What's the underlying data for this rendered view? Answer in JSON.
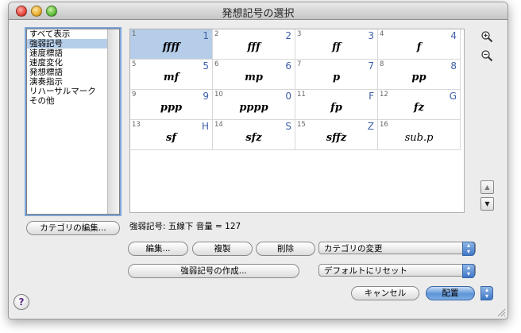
{
  "window": {
    "title": "発想記号の選択"
  },
  "categories": {
    "items": [
      "すべて表示",
      "強弱記号",
      "速度標語",
      "速度変化",
      "発想標語",
      "演奏指示",
      "リハーサルマーク",
      "その他"
    ],
    "selected_index": 1
  },
  "grid": {
    "cells": [
      {
        "num": "1",
        "key": "1",
        "sym": "ffff"
      },
      {
        "num": "2",
        "key": "2",
        "sym": "fff"
      },
      {
        "num": "3",
        "key": "3",
        "sym": "ff"
      },
      {
        "num": "4",
        "key": "4",
        "sym": "f"
      },
      {
        "num": "5",
        "key": "5",
        "sym": "mf"
      },
      {
        "num": "6",
        "key": "6",
        "sym": "mp"
      },
      {
        "num": "7",
        "key": "7",
        "sym": "p"
      },
      {
        "num": "8",
        "key": "8",
        "sym": "pp"
      },
      {
        "num": "9",
        "key": "9",
        "sym": "ppp"
      },
      {
        "num": "10",
        "key": "0",
        "sym": "pppp"
      },
      {
        "num": "11",
        "key": "F",
        "sym": "fp"
      },
      {
        "num": "12",
        "key": "G",
        "sym": "fz"
      },
      {
        "num": "13",
        "key": "H",
        "sym": "sf"
      },
      {
        "num": "14",
        "key": "S",
        "sym": "sfz"
      },
      {
        "num": "15",
        "key": "Z",
        "sym": "sffz"
      },
      {
        "num": "16",
        "key": "",
        "sym": "sub.p"
      }
    ],
    "selected_index": 0
  },
  "status_text": "強弱記号: 五線下 音量 = 127",
  "buttons": {
    "edit_category": "カテゴリの編集...",
    "edit": "編集...",
    "duplicate": "複製",
    "delete": "削除",
    "create": "強弱記号の作成...",
    "cancel": "キャンセル",
    "place": "配置"
  },
  "popups": {
    "change_category": "カテゴリの変更",
    "reset": "デフォルトにリセット"
  },
  "icons": {
    "zoom_in": "zoom-in-icon",
    "zoom_out": "zoom-out-icon",
    "scroll_up": "▲",
    "scroll_down": "▼",
    "help": "?"
  },
  "colors": {
    "selection": "#b5cde8",
    "key_text": "#3e5fa8",
    "primary_button": "#5d95d8"
  }
}
